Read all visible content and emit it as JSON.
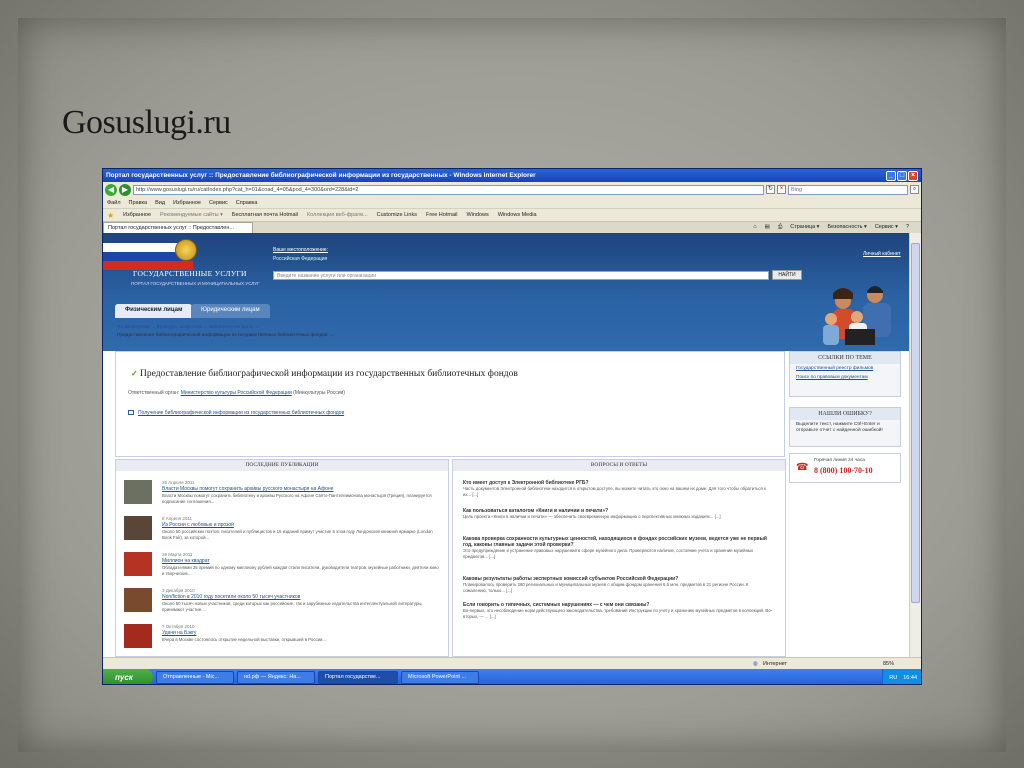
{
  "slide": {
    "title": "Gosuslugi.ru"
  },
  "window": {
    "title": "Портал государственных услуг :: Предоставление библиографической информации из государственных - Windows Internet Explorer",
    "url": "http://www.gosuslugi.ru/ru/catIndex.php?cat_h=01&coad_4=05&pod_4=300&ord=228&id=2",
    "search_placeholder": "Bing",
    "menu": [
      "Файл",
      "Правка",
      "Вид",
      "Избранное",
      "Сервис",
      "Справка"
    ],
    "favorites_label": "Избранное",
    "favorites": [
      "Рекомендуемые сайты ▾",
      "Бесплатная почта Hotmail",
      "Коллекция веб-фрагм...",
      "Customize Links",
      "Free Hotmail",
      "Windows",
      "Windows Media"
    ],
    "tab_title": "Портал государственных услуг :: Предоставлен...",
    "tab_tools": [
      "Страница ▾",
      "Безопасность ▾",
      "Сервис ▾"
    ]
  },
  "site": {
    "brand_line1": "ГОСУДАРСТВЕННЫЕ УСЛУГИ",
    "brand_line2": "ПОРТАЛ ГОСУДАРСТВЕННЫХ И МУНИЦИПАЛЬНЫХ УСЛУГ",
    "location_link": "Ваше местоположение:",
    "location_value": "Российская Федерация",
    "search_placeholder": "Введите название услуги или организации",
    "search_button": "НАЙТИ",
    "cabinet": "Личный кабинет",
    "tab_individuals": "Физическим лицам",
    "tab_legal": "Юридическим лицам",
    "breadcrumb": "По категориям → Культура, искусство → Библиотечное дело →",
    "breadcrumb_current": "Предоставление библиографической информации из государственных библиотечных фондов →"
  },
  "service": {
    "title": "Предоставление библиографической информации из государственных библиотечных фондов",
    "dept_label": "Ответственный орган:",
    "dept_link": "Министерство культуры Российской Федерации",
    "dept_short": "(Минкультуры России)",
    "doc_link": "Получение библиографической информации из государственных библиотечных фондов"
  },
  "sidebar": {
    "related_title": "ССЫЛКИ ПО ТЕМЕ",
    "related_links": [
      "Государственный реестр фильмов",
      "Поиск по правовым документам"
    ],
    "error_title": "НАШЛИ ОШИБКУ?",
    "error_text": "Выделите текст, нажмите Ctrl+Enter и отправьте отчет с найденной ошибкой!",
    "hotline_label": "Горячая линия 24 часа",
    "hotline_number": "8 (800) 100-70-10"
  },
  "publications": {
    "title": "ПОСЛЕДНИЕ ПУБЛИКАЦИИ",
    "items": [
      {
        "date": "25 Апреля 2011",
        "title": "Власти Москвы помогут сохранить архивы русского монастыря на Афоне",
        "text": "Власти Москвы помогут сохранить библиотеку и архивы Русского на Афоне Свято-Пантелеимонова монастыря (Греция), планируется подписание соглашения..."
      },
      {
        "date": "8 Апреля 2011",
        "title": "Из России с любовью и прозой",
        "text": "Около 50 российских поэтов, писателей и публицистов и 15 изданий примут участие в этом году Лондонской книжной ярмарке (London Book Fair), за которой..."
      },
      {
        "date": "29 Марта 2011",
        "title": "Миллион на квадрат",
        "text": "Обладателями 25 премий по одному миллиону рублей каждая стали писатели, руководители театров, музейные работники, деятели кино и творческие..."
      },
      {
        "date": "3 Декабря 2010",
        "title": "Non/fiction в 2010 году посетили около 50 тысяч участников",
        "text": "Около 50 тысяч новых участников, среди которых как российские, так и зарубежные издательства интеллектуальной литературы, принимают участие..."
      },
      {
        "date": "7 Октября 2010",
        "title": "Удачи на Бэкгу",
        "text": "Вчера в Москве состоялось открытие недельной выставки, открывшей в России..."
      }
    ]
  },
  "questions": {
    "title": "ВОПРОСЫ И ОТВЕТЫ",
    "items": [
      {
        "q": "Кто имеет доступ к Электронной библиотеке РГБ?",
        "a": "Часть документов Электронной библиотеки находится в открытом доступе, вы можете читать это окно на вашем их доме. Для того чтобы обратиться к их... [...]"
      },
      {
        "q": "Как пользоваться каталогом «Книги в наличии и печати»?",
        "a": "Цель проекта «Книги в наличии и печати» — обеспечить своевременную информацию о перспективных книжных изданиях... [...]"
      },
      {
        "q": "Какова проверка сохранности культурных ценностей, находящихся в фондах российских музеев, ведется уже не первый год, каковы главные задачи этой проверки?",
        "a": "Это предупреждение и устранение правовых нарушений в сфере музейного дела. Проверяются наличие, состояние учета и хранения музейных предметов... [...]"
      },
      {
        "q": "Каковы результаты работы экспертных комиссий субъектов Российской Федерации?",
        "a": "Планировалось проверить 280 региональных и муниципальных музеев с общим фондом хранения 6,5 млн. предметов в 21 регионе России. К сожалению, только... [...]"
      },
      {
        "q": "Если говорить о типичных, системных нарушениях — с чем они связаны?",
        "a": "Во-первых, это несоблюдение норм действующего законодательства, требований Инструкции по учету и хранению музейных предметов в коллекций. Во-вторых, — ... [...]"
      }
    ]
  },
  "statusbar": {
    "zone": "Интернет",
    "zoom": "85%"
  },
  "taskbar": {
    "start": "пуск",
    "items": [
      "Отправленные - Mic...",
      "нd.рф — Яндекс: На...",
      "Портал государстве...",
      "Microsoft PowerPoint ..."
    ],
    "lang": "RU",
    "time": "16:44"
  },
  "colors": {
    "header_blue": "#2b62a4",
    "link": "#1b4f9a",
    "hotline": "#cc2222"
  }
}
